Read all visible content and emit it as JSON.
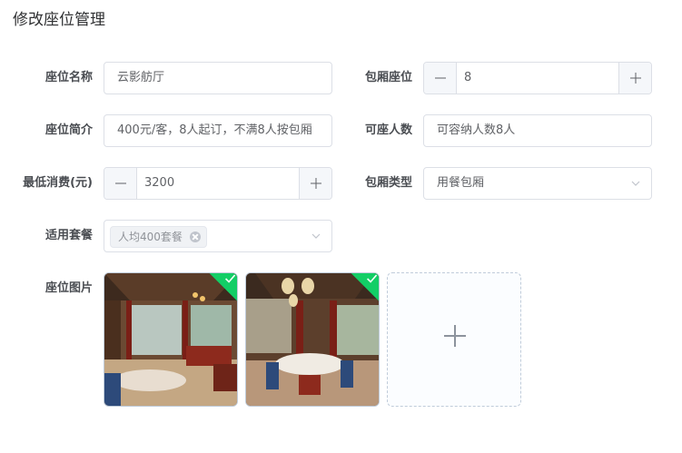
{
  "page": {
    "title": "修改座位管理"
  },
  "form": {
    "seat_name": {
      "label": "座位名称",
      "value": "云影舫厅"
    },
    "private_room": {
      "label": "包厢座位",
      "value": "8"
    },
    "seat_intro": {
      "label": "座位简介",
      "value": "400元/客，8人起订，不满8人按包厢"
    },
    "capacity": {
      "label": "可座人数",
      "value": "可容纳人数8人"
    },
    "min_spend": {
      "label": "最低消费(元)",
      "value": "3200"
    },
    "room_type": {
      "label": "包厢类型",
      "value": "用餐包厢"
    },
    "package": {
      "label": "适用套餐",
      "tags": [
        "人均400套餐"
      ]
    },
    "images": {
      "label": "座位图片",
      "count": 2
    }
  },
  "colors": {
    "success": "#13ce66",
    "border": "#dcdfe6",
    "upload_bg": "#fbfdff"
  }
}
